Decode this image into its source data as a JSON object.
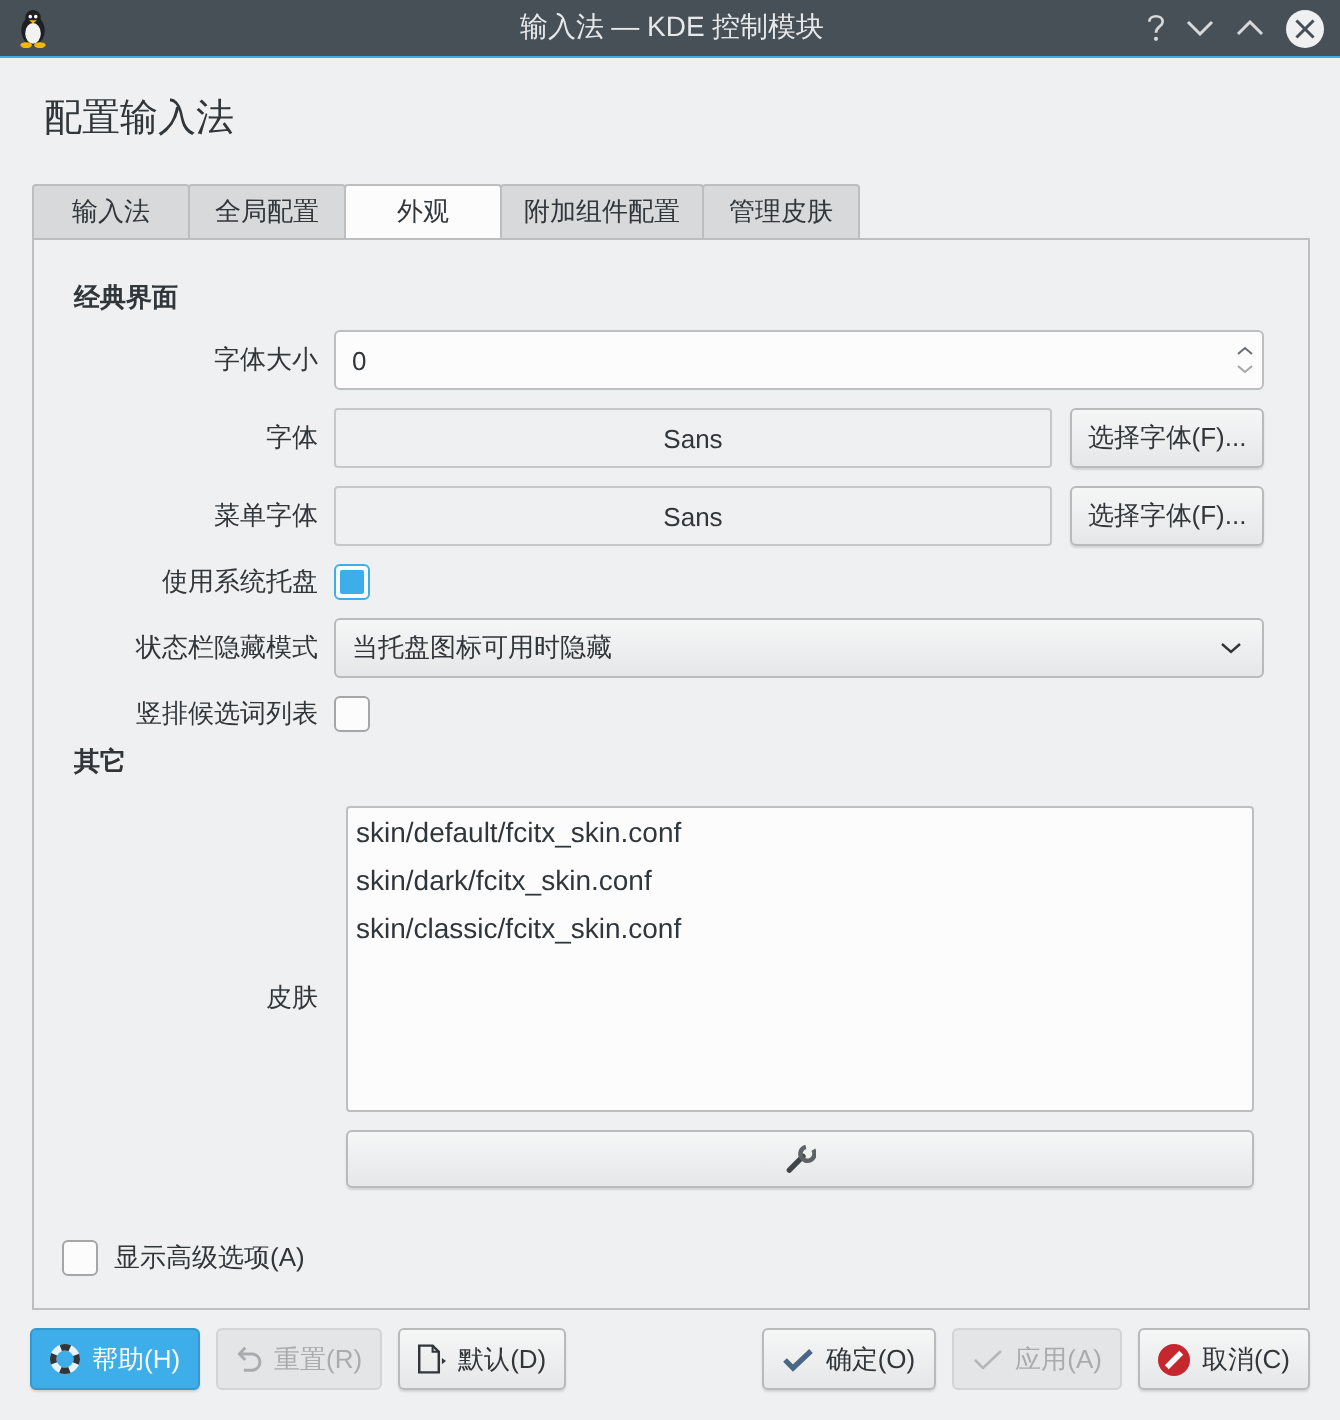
{
  "window": {
    "title": "输入法 — KDE 控制模块"
  },
  "heading": "配置输入法",
  "tabs": [
    {
      "label": "输入法",
      "selected": false
    },
    {
      "label": "全局配置",
      "selected": false
    },
    {
      "label": "外观",
      "selected": true
    },
    {
      "label": "附加组件配置",
      "selected": false
    },
    {
      "label": "管理皮肤",
      "selected": false
    }
  ],
  "classic": {
    "title": "经典界面",
    "rows": [
      {
        "kind": "spinbox",
        "label": "字体大小",
        "value": "0"
      },
      {
        "kind": "font",
        "label": "字体",
        "value": "Sans",
        "button": "选择字体(F)..."
      },
      {
        "kind": "font",
        "label": "菜单字体",
        "value": "Sans",
        "button": "选择字体(F)..."
      },
      {
        "kind": "checkbox",
        "label": "使用系统托盘",
        "checked": true
      },
      {
        "kind": "combo",
        "label": "状态栏隐藏模式",
        "value": "当托盘图标可用时隐藏"
      },
      {
        "kind": "checkbox",
        "label": "竖排候选词列表",
        "checked": false
      }
    ]
  },
  "other": {
    "title": "其它",
    "skin": {
      "label": "皮肤",
      "items": [
        {
          "text": "skin/default/fcitx_skin.conf",
          "selected": false
        },
        {
          "text": "skin/dark/fcitx_skin.conf",
          "selected": false
        },
        {
          "text": "skin/classic/fcitx_skin.conf",
          "selected": false
        }
      ]
    }
  },
  "advanced": {
    "label": "显示高级选项(A)",
    "checked": false
  },
  "buttons": {
    "left": [
      {
        "kind": "help",
        "label": "帮助(H)",
        "focused": true,
        "disabled": false
      },
      {
        "kind": "reset",
        "label": "重置(R)",
        "focused": false,
        "disabled": true
      },
      {
        "kind": "defaults",
        "label": "默认(D)",
        "focused": false,
        "disabled": false
      }
    ],
    "right": [
      {
        "kind": "ok",
        "label": "确定(O)",
        "focused": false,
        "disabled": false
      },
      {
        "kind": "apply",
        "label": "应用(A)",
        "focused": false,
        "disabled": true
      },
      {
        "kind": "cancel",
        "label": "取消(C)",
        "focused": false,
        "disabled": false
      }
    ]
  }
}
